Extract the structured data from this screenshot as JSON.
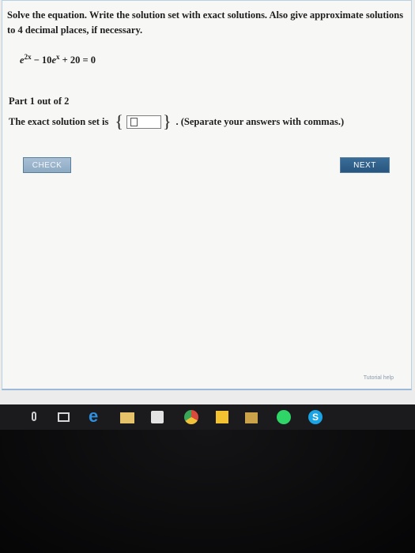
{
  "problem": {
    "instructions": "Solve the equation. Write the solution set with exact solutions. Also give approximate solutions to 4 decimal places, if necessary.",
    "equation": {
      "term1_base": "e",
      "term1_exp": "2x",
      "minus": " − 10",
      "term2_base": "e",
      "term2_exp": "x",
      "rest": " + 20 = 0"
    }
  },
  "part": {
    "label": "Part 1 out of 2"
  },
  "solution": {
    "prefix": "The exact solution set is",
    "open_brace": "{",
    "close_brace": "}",
    "hint": ". (Separate your answers with commas.)",
    "value": ""
  },
  "buttons": {
    "check": "CHECK",
    "next": "NEXT"
  },
  "footer": {
    "tutorial": "Tutorial help"
  },
  "taskbar": {
    "icons": [
      "microphone-icon",
      "task-view-icon",
      "edge-icon",
      "file-explorer-icon",
      "store-icon",
      "chrome-icon",
      "sticky-notes-icon",
      "folder-icon",
      "spotify-icon",
      "skype-icon"
    ],
    "skype_glyph": "S"
  },
  "colors": {
    "next_button": "#2c5a84",
    "check_button": "#9bb5cd",
    "panel_border": "#b9cfe2",
    "taskbar": "#1b1b1e"
  }
}
